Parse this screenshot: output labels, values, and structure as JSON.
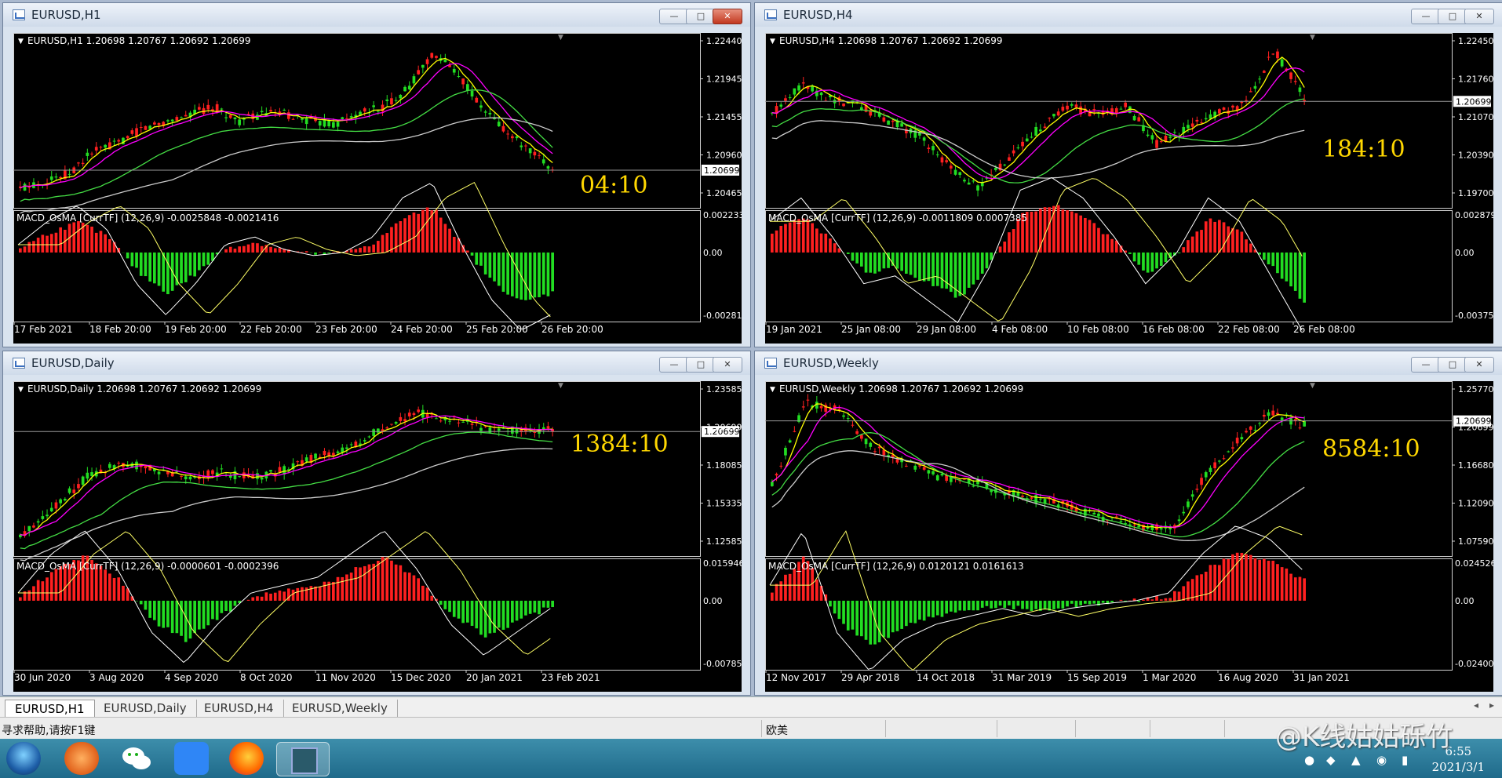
{
  "windows": [
    {
      "title": "EURUSD,H1",
      "info": "EURUSD,H1  1.20698 1.20767 1.20692 1.20699",
      "price_ticks": [
        "1.22440",
        "1.21945",
        "1.21455",
        "1.20960",
        "1.20465"
      ],
      "current_price": "1.20699",
      "countdown": "04:10",
      "macd_label": "MACD_OsMA [CurrTF] (12,26,9) -0.0025848 -0.0021416",
      "macd_ticks": [
        "0.0022332",
        "0.00",
        "-0.0028142"
      ],
      "date_labels": [
        "17 Feb 2021",
        "18 Feb 20:00",
        "19 Feb 20:00",
        "22 Feb 20:00",
        "23 Feb 20:00",
        "24 Feb 20:00",
        "25 Feb 20:00",
        "26 Feb 20:00"
      ],
      "close_active": true
    },
    {
      "title": "EURUSD,H4",
      "info": "EURUSD,H4  1.20698 1.20767 1.20692 1.20699",
      "price_ticks": [
        "1.22450",
        "1.21760",
        "1.21070",
        "1.20390",
        "1.19700"
      ],
      "current_price": "1.20699",
      "countdown": "184:10",
      "macd_label": "MACD_OsMA [CurrTF] (12,26,9) -0.0011809 0.0007385",
      "macd_ticks": [
        "0.0028796",
        "0.00",
        "-0.0037568"
      ],
      "date_labels": [
        "19 Jan 2021",
        "25 Jan 08:00",
        "29 Jan 08:00",
        "4 Feb 08:00",
        "10 Feb 08:00",
        "16 Feb 08:00",
        "22 Feb 08:00",
        "26 Feb 08:00"
      ],
      "close_active": false
    },
    {
      "title": "EURUSD,Daily",
      "info": "EURUSD,Daily  1.20698 1.20767 1.20692 1.20699",
      "price_ticks": [
        "1.23585",
        "1.20699",
        "1.18085",
        "1.15335",
        "1.12585"
      ],
      "current_price": "1.20699",
      "countdown": "1384:10",
      "macd_label": "MACD_OsMA [CurrTF] (12,26,9) -0.0000601 -0.0002396",
      "macd_ticks": [
        "0.0159468",
        "0.00",
        "-0.0078573"
      ],
      "date_labels": [
        "30 Jun 2020",
        "3 Aug 2020",
        "4 Sep 2020",
        "8 Oct 2020",
        "11 Nov 2020",
        "15 Dec 2020",
        "20 Jan 2021",
        "23 Feb 2021"
      ],
      "close_active": false
    },
    {
      "title": "EURUSD,Weekly",
      "info": "EURUSD,Weekly  1.20698 1.20767 1.20692 1.20699",
      "price_ticks": [
        "1.25770",
        "1.20699",
        "1.16680",
        "1.12090",
        "1.07590"
      ],
      "current_price": "1.20699",
      "countdown": "8584:10",
      "macd_label": "MACD_OsMA [CurrTF] (12,26,9) 0.0120121 0.0161613",
      "macd_ticks": [
        "0.0245267",
        "0.00",
        "-0.0240031"
      ],
      "date_labels": [
        "12 Nov 2017",
        "29 Apr 2018",
        "14 Oct 2018",
        "31 Mar 2019",
        "15 Sep 2019",
        "1 Mar 2020",
        "16 Aug 2020",
        "31 Jan 2021"
      ],
      "close_active": false
    }
  ],
  "window_buttons": {
    "minimize": "—",
    "maximize": "□",
    "close": "✕"
  },
  "tabs": [
    "EURUSD,H1",
    "EURUSD,Daily",
    "EURUSD,H4",
    "EURUSD,Weekly"
  ],
  "status": {
    "help": "寻求帮助,请按F1键",
    "profile": "欧美"
  },
  "taskbar": {
    "apps": [
      "start-orb",
      "app-orange",
      "wechat-app",
      "feishu-app",
      "firefox-app",
      "terminal-app"
    ],
    "time": "6:55",
    "date": "2021/3/1"
  },
  "watermark": "@K线姑姑砾竹",
  "colors": {
    "bull": "#ff2020",
    "bear": "#22dd22",
    "ma_fast": "#ffff00",
    "ma_mid": "#ff00ff",
    "ma_slow": "#44dd44",
    "ma_long": "#cccccc",
    "countdown": "#ffd700"
  }
}
